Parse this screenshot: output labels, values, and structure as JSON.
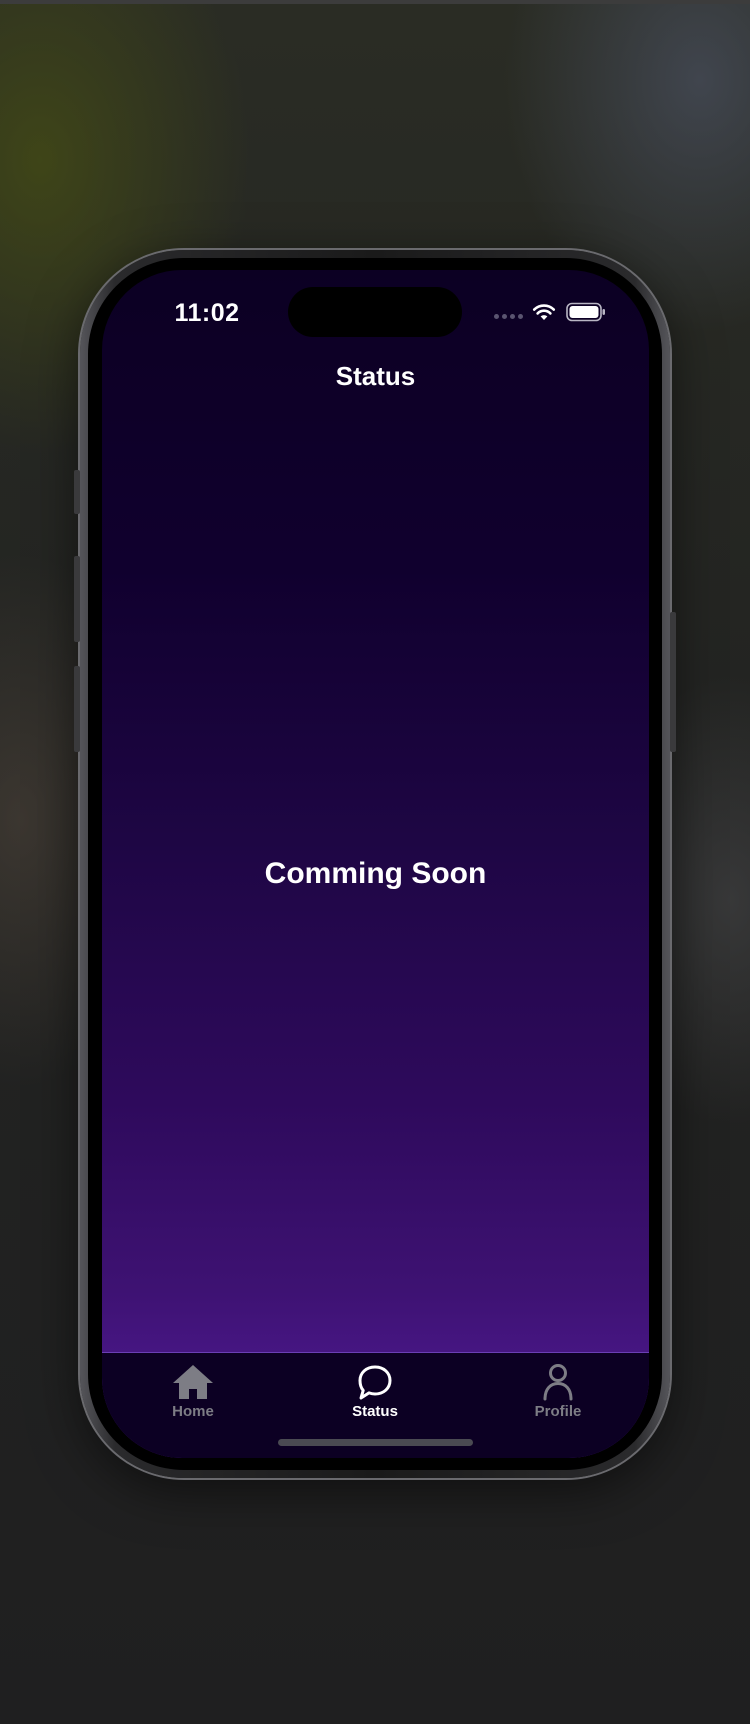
{
  "status_bar": {
    "time": "11:02",
    "signal_icon": "cellular-signal-icon",
    "wifi_icon": "wifi-icon",
    "battery_icon": "battery-full-icon"
  },
  "header": {
    "title": "Status"
  },
  "main": {
    "message": "Comming Soon"
  },
  "tab_bar": {
    "items": [
      {
        "label": "Home",
        "icon": "home-icon",
        "active": false
      },
      {
        "label": "Status",
        "icon": "chat-bubble-icon",
        "active": true
      },
      {
        "label": "Profile",
        "icon": "person-icon",
        "active": false
      }
    ]
  },
  "colors": {
    "background_top": "#0c0023",
    "background_bottom": "#531c9b",
    "tab_active": "#ffffff",
    "tab_inactive": "#7d7d85"
  }
}
